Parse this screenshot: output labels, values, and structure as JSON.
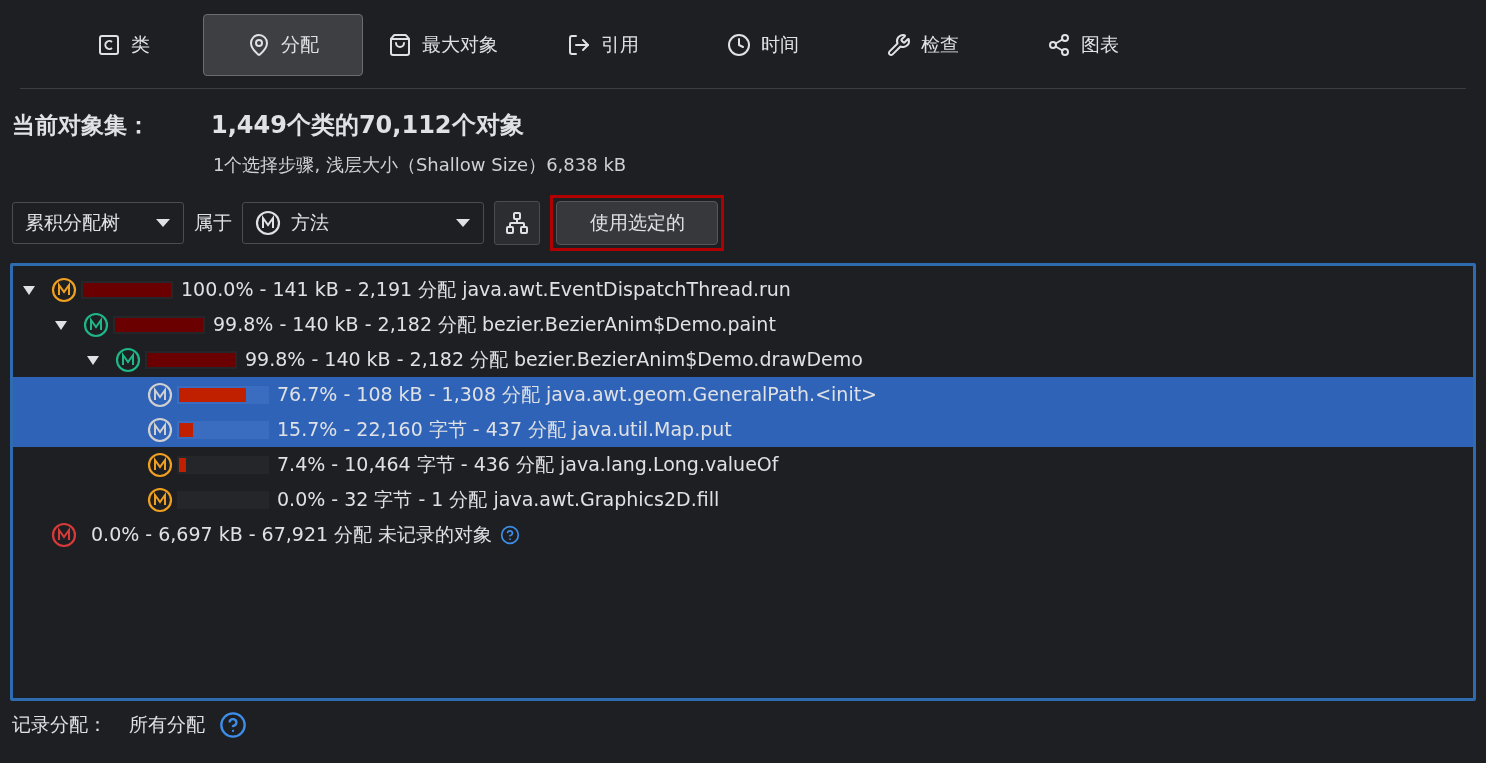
{
  "tabs": [
    {
      "kind": "class",
      "label": "类",
      "selected": false
    },
    {
      "kind": "pin",
      "label": "分配",
      "selected": true
    },
    {
      "kind": "bag",
      "label": "最大对象",
      "selected": false
    },
    {
      "kind": "export",
      "label": "引用",
      "selected": false
    },
    {
      "kind": "clock",
      "label": "时间",
      "selected": false
    },
    {
      "kind": "wrench",
      "label": "检查",
      "selected": false
    },
    {
      "kind": "graph",
      "label": "图表",
      "selected": false
    }
  ],
  "summary": {
    "label": "当前对象集：",
    "headline": "1,449个类的70,112个对象",
    "detail": "1个选择步骤, 浅层大小（Shallow Size）6,838 kB"
  },
  "controls": {
    "view_select": "累积分配树",
    "of_label": "属于",
    "grouping_select": "方法",
    "apply_button": "使用选定的"
  },
  "tree": [
    {
      "kind": "method",
      "color": "#f0a020",
      "level": 1.0,
      "text": "100.0% - 141 kB - 2,191 分配 java.awt.EventDispatchThread.run",
      "selected": false,
      "expanded": true,
      "children": [
        {
          "kind": "method",
          "color": "#1fb785",
          "level": 0.998,
          "text": "99.8% - 140 kB - 2,182 分配 bezier.BezierAnim$Demo.paint",
          "selected": false,
          "expanded": true,
          "children": [
            {
              "kind": "method",
              "color": "#1fb785",
              "level": 0.998,
              "text": "99.8% - 140 kB - 2,182 分配 bezier.BezierAnim$Demo.drawDemo",
              "selected": false,
              "expanded": true,
              "children": [
                {
                  "kind": "method",
                  "color": "#d0d0d0",
                  "level": 0.767,
                  "text": "76.7% - 108 kB - 1,308 分配 java.awt.geom.GeneralPath.<init>",
                  "selected": true
                },
                {
                  "kind": "method",
                  "color": "#d0d0d0",
                  "level": 0.157,
                  "text": "15.7% - 22,160 字节 - 437 分配 java.util.Map.put",
                  "selected": true
                },
                {
                  "kind": "method",
                  "color": "#f0a020",
                  "level": 0.074,
                  "text": "7.4% - 10,464 字节 - 436 分配 java.lang.Long.valueOf",
                  "selected": false
                },
                {
                  "kind": "method",
                  "color": "#f0a020",
                  "level": 0.0,
                  "text": "0.0% - 32 字节 - 1 分配 java.awt.Graphics2D.fill",
                  "selected": false
                }
              ]
            }
          ]
        }
      ]
    },
    {
      "kind": "unrecorded",
      "color": "#d83a3a",
      "text": "0.0% - 6,697 kB - 67,921 分配 未记录的对象",
      "selected": false
    }
  ],
  "footer": {
    "label": "记录分配：",
    "value": "所有分配"
  }
}
